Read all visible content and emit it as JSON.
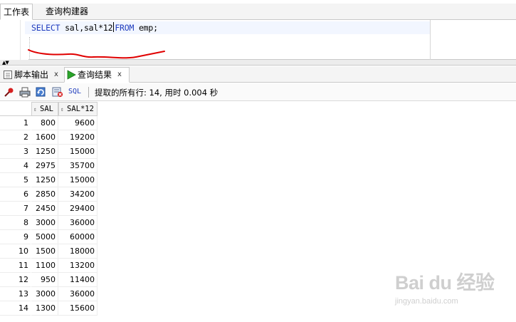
{
  "top_tabs": [
    "工作表",
    "查询构建器"
  ],
  "editor": {
    "line": {
      "kw_select": "SELECT",
      "columns": " sal,sal*12",
      "kw_from": "FROM",
      "table": " emp;"
    }
  },
  "bottom_tabs": [
    {
      "label": "脚本输出",
      "close": "x",
      "icon": "script-output-icon"
    },
    {
      "label": "查询结果",
      "close": "x",
      "icon": "play-icon"
    }
  ],
  "toolbar": {
    "sql_label": "SQL",
    "status": "提取的所有行: 14, 用时 0.004 秒",
    "icons": [
      "pin-icon",
      "print-icon",
      "refresh-icon",
      "clear-icon"
    ]
  },
  "grid": {
    "columns": [
      "SAL",
      "SAL*12"
    ],
    "rows": [
      [
        "1",
        "800",
        "9600"
      ],
      [
        "2",
        "1600",
        "19200"
      ],
      [
        "3",
        "1250",
        "15000"
      ],
      [
        "4",
        "2975",
        "35700"
      ],
      [
        "5",
        "1250",
        "15000"
      ],
      [
        "6",
        "2850",
        "34200"
      ],
      [
        "7",
        "2450",
        "29400"
      ],
      [
        "8",
        "3000",
        "36000"
      ],
      [
        "9",
        "5000",
        "60000"
      ],
      [
        "10",
        "1500",
        "18000"
      ],
      [
        "11",
        "1100",
        "13200"
      ],
      [
        "12",
        "950",
        "11400"
      ],
      [
        "13",
        "3000",
        "36000"
      ],
      [
        "14",
        "1300",
        "15600"
      ]
    ]
  },
  "watermark": {
    "main": "Bai du 经验",
    "sub": "jingyan.baidu.com"
  },
  "colors": {
    "keyword": "#1e3bbd",
    "annotation": "#e00000",
    "play": "#2aa52a"
  }
}
